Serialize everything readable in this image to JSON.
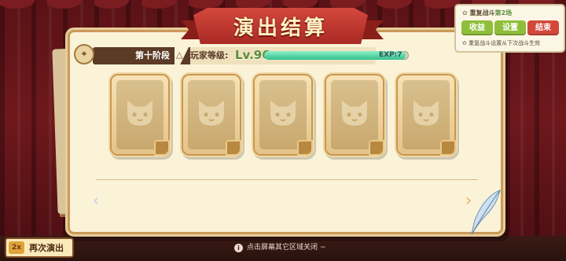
{
  "title": "演出结算",
  "stage": {
    "label": "第十阶段"
  },
  "player": {
    "level_label": "玩家等级:",
    "level_value": "Lv.96",
    "exp_label": "EXP:7",
    "exp_progress_percent": 98
  },
  "cards": [
    {
      "icon": "cat-emblem-icon",
      "state": "locked"
    },
    {
      "icon": "cat-emblem-icon",
      "state": "locked"
    },
    {
      "icon": "cat-emblem-icon",
      "state": "locked"
    },
    {
      "icon": "cat-emblem-icon",
      "state": "locked"
    },
    {
      "icon": "cat-emblem-icon",
      "state": "locked"
    }
  ],
  "popup": {
    "title_prefix": "重复战斗",
    "title_highlight": "第2场",
    "buttons": {
      "earnings": "收益",
      "settings": "设置",
      "end": "结束"
    },
    "note": "重复战斗设置从下次战斗生效"
  },
  "replay": {
    "label": "再次演出",
    "icon_text": "2x"
  },
  "hint": {
    "text": "点击屏幕其它区域关闭 ~",
    "icon": "i"
  },
  "colors": {
    "title_ribbon": "#c93a31",
    "level_green": "#5a8d3a",
    "exp_fill": "#34c08c",
    "btn_green": "#8fbf3a",
    "btn_red": "#d3483b"
  }
}
